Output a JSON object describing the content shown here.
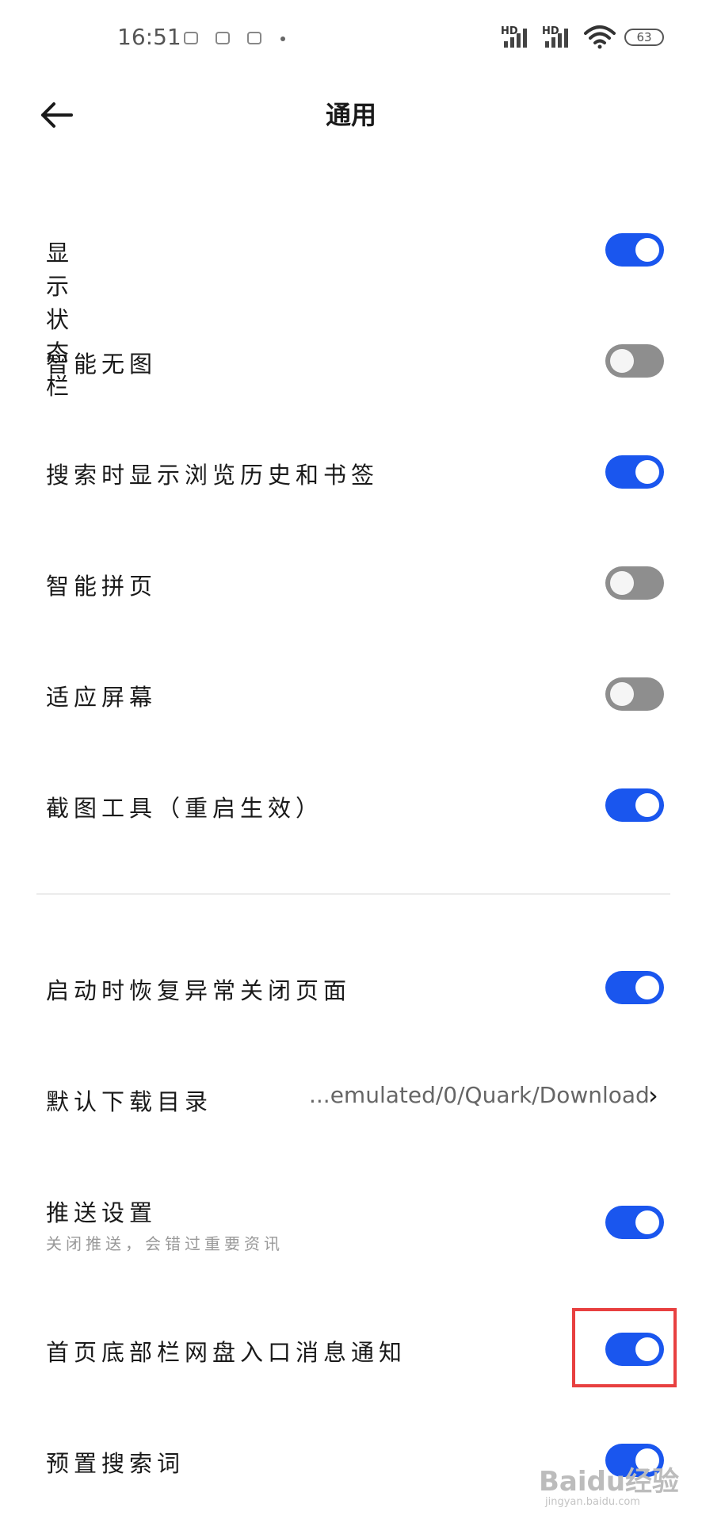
{
  "status_bar": {
    "time": "16:51",
    "hd1": "HD",
    "hd2": "HD",
    "battery": "63",
    "icons": [
      "notification-icon",
      "notification-icon",
      "notification-icon",
      "dot-icon",
      "signal-icon",
      "signal-icon",
      "wifi-icon",
      "battery-icon"
    ]
  },
  "header": {
    "title": "通用",
    "back_icon": "arrow-left-icon"
  },
  "settings": [
    {
      "label": "显示状态栏",
      "enabled": true
    },
    {
      "label": "智能无图",
      "enabled": false
    },
    {
      "label": "搜索时显示浏览历史和书签",
      "enabled": true
    },
    {
      "label": "智能拼页",
      "enabled": false
    },
    {
      "label": "适应屏幕",
      "enabled": false
    },
    {
      "label": "截图工具（重启生效）",
      "enabled": true
    },
    {
      "label": "启动时恢复异常关闭页面",
      "enabled": true
    },
    {
      "label": "默认下载目录",
      "value": "...emulated/0/Quark/Download",
      "chevron": "›"
    },
    {
      "label": "推送设置",
      "sublabel": "关闭推送，会错过重要资讯",
      "enabled": true
    },
    {
      "label": "首页底部栏网盘入口消息通知",
      "enabled": true
    },
    {
      "label": "预置搜索词",
      "enabled": true
    }
  ],
  "colors": {
    "toggle_on": "#1a56ee",
    "toggle_off": "#8e8e8e",
    "highlight": "#e84040"
  },
  "watermark": {
    "text": "Baidu经验",
    "sub": "jingyan.baidu.com"
  }
}
